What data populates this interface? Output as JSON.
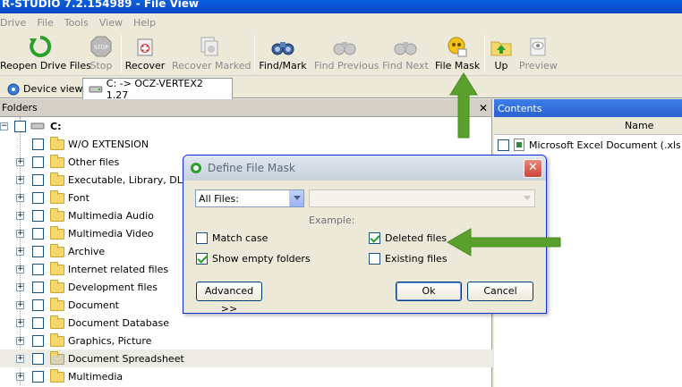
{
  "window": {
    "title": "R-STUDIO 7.2.154989 - File View"
  },
  "menu": [
    "Drive",
    "File",
    "Tools",
    "View",
    "Help"
  ],
  "toolbar": {
    "buttons": [
      {
        "label": "Reopen Drive Files",
        "icon": "reopen-icon",
        "enabled": true
      },
      {
        "label": "Stop",
        "icon": "stop-icon",
        "enabled": false
      },
      {
        "label": "Recover",
        "icon": "recover-icon",
        "enabled": true
      },
      {
        "label": "Recover Marked",
        "icon": "recover-marked-icon",
        "enabled": false
      },
      {
        "label": "Find/Mark",
        "icon": "binoculars-icon",
        "enabled": true
      },
      {
        "label": "Find Previous",
        "icon": "binoculars-icon",
        "enabled": false
      },
      {
        "label": "Find Next",
        "icon": "binoculars-icon",
        "enabled": false
      },
      {
        "label": "File Mask",
        "icon": "file-mask-icon",
        "enabled": true
      },
      {
        "label": "Up",
        "icon": "folder-up-icon",
        "enabled": true
      },
      {
        "label": "Preview",
        "icon": "eye-icon",
        "enabled": false
      }
    ]
  },
  "tabs": [
    {
      "label": "Device view",
      "active": false
    },
    {
      "label": "C: -> OCZ-VERTEX2 1.27",
      "active": true
    }
  ],
  "folders_panel": {
    "header": "Folders",
    "close_symbol": "✕",
    "root": "C:",
    "items": [
      "W/O EXTENSION",
      "Other files",
      "Executable, Library, DLL",
      "Font",
      "Multimedia Audio",
      "Multimedia Video",
      "Archive",
      "Internet related files",
      "Development files",
      "Document",
      "Document Database",
      "Graphics, Picture",
      "Document Spreadsheet",
      "Multimedia"
    ],
    "selected_item": "Document Spreadsheet"
  },
  "contents_panel": {
    "header": "Contents",
    "column_name": "Name",
    "rows": [
      "Microsoft Excel Document (.xls)"
    ]
  },
  "dialog": {
    "title": "Define File Mask",
    "close_symbol": "✕",
    "file_type_value": "All Files:",
    "example_label": "Example:",
    "checkboxes": [
      {
        "label": "Match case",
        "checked": false
      },
      {
        "label": "Show empty folders",
        "checked": true
      },
      {
        "label": "Deleted files",
        "checked": true
      },
      {
        "label": "Existing files",
        "checked": false
      }
    ],
    "advanced_label": "Advanced >>",
    "ok_label": "Ok",
    "cancel_label": "Cancel"
  },
  "colors": {
    "annotation_arrow": "#5aa02c",
    "selection": "#ecebe4",
    "title_bar": "#0a5fe0"
  }
}
